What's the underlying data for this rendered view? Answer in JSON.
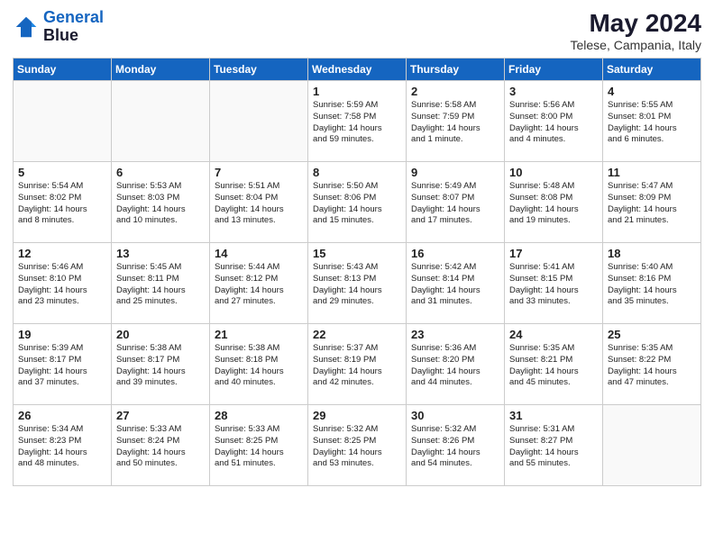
{
  "logo": {
    "line1": "General",
    "line2": "Blue"
  },
  "title": "May 2024",
  "location": "Telese, Campania, Italy",
  "days_of_week": [
    "Sunday",
    "Monday",
    "Tuesday",
    "Wednesday",
    "Thursday",
    "Friday",
    "Saturday"
  ],
  "weeks": [
    [
      {
        "day": null,
        "lines": []
      },
      {
        "day": null,
        "lines": []
      },
      {
        "day": null,
        "lines": []
      },
      {
        "day": "1",
        "lines": [
          "Sunrise: 5:59 AM",
          "Sunset: 7:58 PM",
          "Daylight: 14 hours",
          "and 59 minutes."
        ]
      },
      {
        "day": "2",
        "lines": [
          "Sunrise: 5:58 AM",
          "Sunset: 7:59 PM",
          "Daylight: 14 hours",
          "and 1 minute."
        ]
      },
      {
        "day": "3",
        "lines": [
          "Sunrise: 5:56 AM",
          "Sunset: 8:00 PM",
          "Daylight: 14 hours",
          "and 4 minutes."
        ]
      },
      {
        "day": "4",
        "lines": [
          "Sunrise: 5:55 AM",
          "Sunset: 8:01 PM",
          "Daylight: 14 hours",
          "and 6 minutes."
        ]
      }
    ],
    [
      {
        "day": "5",
        "lines": [
          "Sunrise: 5:54 AM",
          "Sunset: 8:02 PM",
          "Daylight: 14 hours",
          "and 8 minutes."
        ]
      },
      {
        "day": "6",
        "lines": [
          "Sunrise: 5:53 AM",
          "Sunset: 8:03 PM",
          "Daylight: 14 hours",
          "and 10 minutes."
        ]
      },
      {
        "day": "7",
        "lines": [
          "Sunrise: 5:51 AM",
          "Sunset: 8:04 PM",
          "Daylight: 14 hours",
          "and 13 minutes."
        ]
      },
      {
        "day": "8",
        "lines": [
          "Sunrise: 5:50 AM",
          "Sunset: 8:06 PM",
          "Daylight: 14 hours",
          "and 15 minutes."
        ]
      },
      {
        "day": "9",
        "lines": [
          "Sunrise: 5:49 AM",
          "Sunset: 8:07 PM",
          "Daylight: 14 hours",
          "and 17 minutes."
        ]
      },
      {
        "day": "10",
        "lines": [
          "Sunrise: 5:48 AM",
          "Sunset: 8:08 PM",
          "Daylight: 14 hours",
          "and 19 minutes."
        ]
      },
      {
        "day": "11",
        "lines": [
          "Sunrise: 5:47 AM",
          "Sunset: 8:09 PM",
          "Daylight: 14 hours",
          "and 21 minutes."
        ]
      }
    ],
    [
      {
        "day": "12",
        "lines": [
          "Sunrise: 5:46 AM",
          "Sunset: 8:10 PM",
          "Daylight: 14 hours",
          "and 23 minutes."
        ]
      },
      {
        "day": "13",
        "lines": [
          "Sunrise: 5:45 AM",
          "Sunset: 8:11 PM",
          "Daylight: 14 hours",
          "and 25 minutes."
        ]
      },
      {
        "day": "14",
        "lines": [
          "Sunrise: 5:44 AM",
          "Sunset: 8:12 PM",
          "Daylight: 14 hours",
          "and 27 minutes."
        ]
      },
      {
        "day": "15",
        "lines": [
          "Sunrise: 5:43 AM",
          "Sunset: 8:13 PM",
          "Daylight: 14 hours",
          "and 29 minutes."
        ]
      },
      {
        "day": "16",
        "lines": [
          "Sunrise: 5:42 AM",
          "Sunset: 8:14 PM",
          "Daylight: 14 hours",
          "and 31 minutes."
        ]
      },
      {
        "day": "17",
        "lines": [
          "Sunrise: 5:41 AM",
          "Sunset: 8:15 PM",
          "Daylight: 14 hours",
          "and 33 minutes."
        ]
      },
      {
        "day": "18",
        "lines": [
          "Sunrise: 5:40 AM",
          "Sunset: 8:16 PM",
          "Daylight: 14 hours",
          "and 35 minutes."
        ]
      }
    ],
    [
      {
        "day": "19",
        "lines": [
          "Sunrise: 5:39 AM",
          "Sunset: 8:17 PM",
          "Daylight: 14 hours",
          "and 37 minutes."
        ]
      },
      {
        "day": "20",
        "lines": [
          "Sunrise: 5:38 AM",
          "Sunset: 8:17 PM",
          "Daylight: 14 hours",
          "and 39 minutes."
        ]
      },
      {
        "day": "21",
        "lines": [
          "Sunrise: 5:38 AM",
          "Sunset: 8:18 PM",
          "Daylight: 14 hours",
          "and 40 minutes."
        ]
      },
      {
        "day": "22",
        "lines": [
          "Sunrise: 5:37 AM",
          "Sunset: 8:19 PM",
          "Daylight: 14 hours",
          "and 42 minutes."
        ]
      },
      {
        "day": "23",
        "lines": [
          "Sunrise: 5:36 AM",
          "Sunset: 8:20 PM",
          "Daylight: 14 hours",
          "and 44 minutes."
        ]
      },
      {
        "day": "24",
        "lines": [
          "Sunrise: 5:35 AM",
          "Sunset: 8:21 PM",
          "Daylight: 14 hours",
          "and 45 minutes."
        ]
      },
      {
        "day": "25",
        "lines": [
          "Sunrise: 5:35 AM",
          "Sunset: 8:22 PM",
          "Daylight: 14 hours",
          "and 47 minutes."
        ]
      }
    ],
    [
      {
        "day": "26",
        "lines": [
          "Sunrise: 5:34 AM",
          "Sunset: 8:23 PM",
          "Daylight: 14 hours",
          "and 48 minutes."
        ]
      },
      {
        "day": "27",
        "lines": [
          "Sunrise: 5:33 AM",
          "Sunset: 8:24 PM",
          "Daylight: 14 hours",
          "and 50 minutes."
        ]
      },
      {
        "day": "28",
        "lines": [
          "Sunrise: 5:33 AM",
          "Sunset: 8:25 PM",
          "Daylight: 14 hours",
          "and 51 minutes."
        ]
      },
      {
        "day": "29",
        "lines": [
          "Sunrise: 5:32 AM",
          "Sunset: 8:25 PM",
          "Daylight: 14 hours",
          "and 53 minutes."
        ]
      },
      {
        "day": "30",
        "lines": [
          "Sunrise: 5:32 AM",
          "Sunset: 8:26 PM",
          "Daylight: 14 hours",
          "and 54 minutes."
        ]
      },
      {
        "day": "31",
        "lines": [
          "Sunrise: 5:31 AM",
          "Sunset: 8:27 PM",
          "Daylight: 14 hours",
          "and 55 minutes."
        ]
      },
      {
        "day": null,
        "lines": []
      }
    ]
  ]
}
